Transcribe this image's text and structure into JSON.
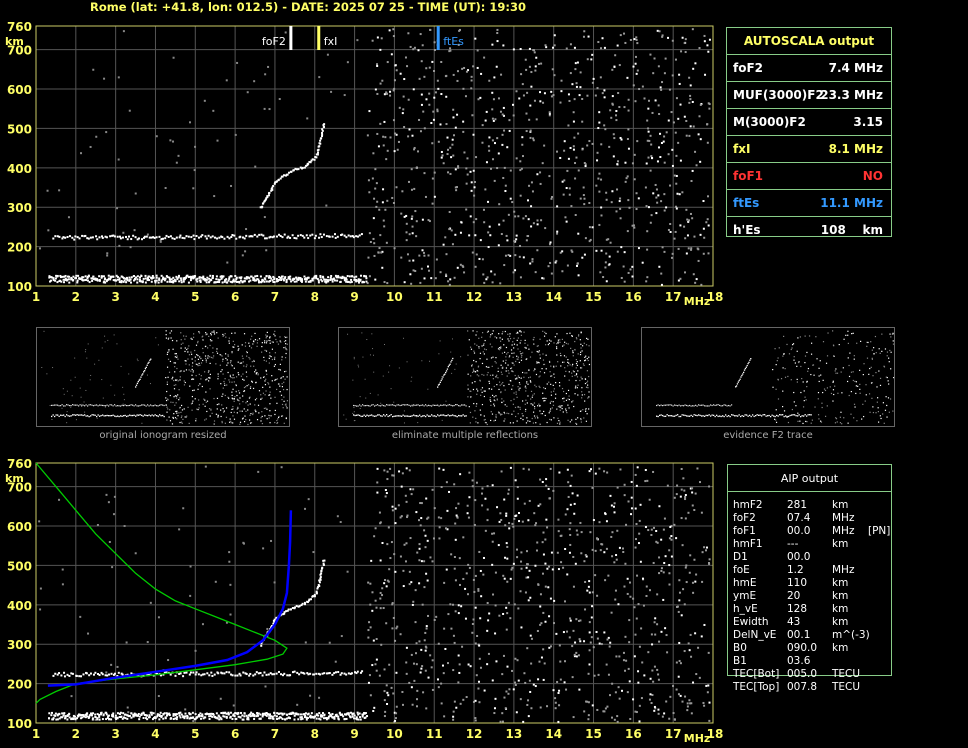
{
  "header": {
    "text": "Rome (lat: +41.8, lon: 012.5) - DATE: 2025 07 25 - TIME (UT): 19:30"
  },
  "top_plot": {
    "markers": {
      "foF2": "foF2",
      "fxI": "fxI",
      "ftEs": "ftEs"
    }
  },
  "autoscala": {
    "title": "AUTOSCALA output",
    "rows": [
      {
        "label": "foF2",
        "value": "7.4 MHz",
        "color": "#ffffff"
      },
      {
        "label": "MUF(3000)F2",
        "value": "23.3 MHz",
        "color": "#ffffff"
      },
      {
        "label": "M(3000)F2",
        "value": "3.15",
        "color": "#ffffff"
      },
      {
        "label": "fxI",
        "value": "8.1 MHz",
        "color": "#ffff66"
      },
      {
        "label": "foF1",
        "value": "NO",
        "color": "#ff3333"
      },
      {
        "label": "ftEs",
        "value": "11.1 MHz",
        "color": "#3399ff"
      },
      {
        "label": "h'Es",
        "value": "108    km",
        "color": "#ffffff"
      }
    ]
  },
  "thumbnails": [
    {
      "caption": "original ionogram resized"
    },
    {
      "caption": "eliminate multiple reflections"
    },
    {
      "caption": "evidence F2 trace"
    }
  ],
  "aip": {
    "title": "AIP output",
    "rows": [
      {
        "name": "hmF2",
        "value": "281",
        "unit": "km",
        "extra": ""
      },
      {
        "name": "foF2",
        "value": "07.4",
        "unit": "MHz",
        "extra": ""
      },
      {
        "name": "foF1",
        "value": "00.0",
        "unit": "MHz",
        "extra": "[PN]"
      },
      {
        "name": "hmF1",
        "value": "---",
        "unit": "km",
        "extra": ""
      },
      {
        "name": "D1",
        "value": "00.0",
        "unit": "",
        "extra": ""
      },
      {
        "name": "foE",
        "value": "1.2",
        "unit": "MHz",
        "extra": ""
      },
      {
        "name": "hmE",
        "value": "110",
        "unit": "km",
        "extra": ""
      },
      {
        "name": "ymE",
        "value": "20",
        "unit": "km",
        "extra": ""
      },
      {
        "name": "h_vE",
        "value": "128",
        "unit": "km",
        "extra": ""
      },
      {
        "name": "Ewidth",
        "value": "43",
        "unit": "km",
        "extra": ""
      },
      {
        "name": "DelN_vE",
        "value": "00.1",
        "unit": "m^(-3)",
        "extra": ""
      },
      {
        "name": "B0",
        "value": "090.0",
        "unit": "km",
        "extra": ""
      },
      {
        "name": "B1",
        "value": "03.6",
        "unit": "",
        "extra": ""
      },
      {
        "name": "TEC[Bot]",
        "value": "005.0",
        "unit": "TECU",
        "extra": ""
      },
      {
        "name": "TEC[Top]",
        "value": "007.8",
        "unit": "TECU",
        "extra": ""
      }
    ]
  },
  "chart_data": [
    {
      "type": "scatter",
      "name": "ionogram",
      "xlabel": "MHz",
      "ylabel": "km",
      "xlim": [
        1,
        18
      ],
      "ylim": [
        100,
        760
      ],
      "xticks": [
        1,
        2,
        3,
        4,
        5,
        6,
        7,
        8,
        9,
        10,
        11,
        12,
        13,
        14,
        15,
        16,
        17,
        18
      ],
      "yticks": [
        100,
        200,
        300,
        400,
        500,
        600,
        700,
        760
      ],
      "grid": true,
      "markers": [
        {
          "name": "foF2",
          "x": 7.4,
          "color": "#ffffff"
        },
        {
          "name": "fxI",
          "x": 8.1,
          "color": "#ffff66"
        },
        {
          "name": "ftEs",
          "x": 11.1,
          "color": "#3399ff"
        }
      ],
      "traces": [
        {
          "name": "Es layer",
          "points": [
            [
              1.3,
              120
            ],
            [
              3,
              120
            ],
            [
              5,
              120
            ],
            [
              7,
              120
            ],
            [
              9.3,
              120
            ]
          ]
        },
        {
          "name": "Es second hop",
          "points": [
            [
              1.4,
              225
            ],
            [
              4,
              226
            ],
            [
              7,
              228
            ],
            [
              9.2,
              230
            ]
          ]
        },
        {
          "name": "F2 trace",
          "points": [
            [
              6.6,
              300
            ],
            [
              7.0,
              370
            ],
            [
              7.4,
              395
            ],
            [
              7.7,
              405
            ],
            [
              8.0,
              430
            ],
            [
              8.1,
              470
            ],
            [
              8.2,
              520
            ]
          ]
        }
      ]
    },
    {
      "type": "line",
      "name": "profile",
      "xlabel": "MHz",
      "ylabel": "km",
      "xlim": [
        1,
        18
      ],
      "ylim": [
        100,
        760
      ],
      "xticks": [
        1,
        2,
        3,
        4,
        5,
        6,
        7,
        8,
        9,
        10,
        11,
        12,
        13,
        14,
        15,
        16,
        17,
        18
      ],
      "yticks": [
        100,
        200,
        300,
        400,
        500,
        600,
        700,
        760
      ],
      "grid": true,
      "series": [
        {
          "color": "#00cc00",
          "points": [
            [
              1.0,
              760
            ],
            [
              1.5,
              700
            ],
            [
              2.0,
              640
            ],
            [
              2.5,
              580
            ],
            [
              3.0,
              530
            ],
            [
              3.5,
              480
            ],
            [
              4.0,
              440
            ],
            [
              4.5,
              410
            ],
            [
              5.0,
              390
            ],
            [
              5.5,
              370
            ],
            [
              6.0,
              350
            ],
            [
              6.5,
              330
            ],
            [
              7.0,
              310
            ],
            [
              7.3,
              290
            ],
            [
              7.2,
              275
            ],
            [
              6.8,
              262
            ],
            [
              6.0,
              248
            ],
            [
              5.0,
              235
            ],
            [
              4.0,
              222
            ],
            [
              3.0,
              212
            ],
            [
              2.0,
              200
            ],
            [
              1.5,
              180
            ],
            [
              1.1,
              160
            ],
            [
              1.0,
              150
            ]
          ]
        },
        {
          "color": "#0000ff",
          "points": [
            [
              1.3,
              195
            ],
            [
              2.0,
              198
            ],
            [
              3.0,
              215
            ],
            [
              4.0,
              230
            ],
            [
              5.0,
              245
            ],
            [
              5.8,
              260
            ],
            [
              6.3,
              280
            ],
            [
              6.7,
              310
            ],
            [
              7.0,
              350
            ],
            [
              7.2,
              390
            ],
            [
              7.3,
              430
            ],
            [
              7.35,
              500
            ],
            [
              7.38,
              560
            ],
            [
              7.4,
              640
            ]
          ]
        }
      ],
      "traces": [
        {
          "name": "Es layer",
          "points": [
            [
              1.3,
              120
            ],
            [
              3,
              120
            ],
            [
              5,
              120
            ],
            [
              7,
              120
            ],
            [
              9.3,
              120
            ]
          ]
        },
        {
          "name": "Es second hop",
          "points": [
            [
              1.4,
              225
            ],
            [
              4,
              226
            ],
            [
              7,
              228
            ],
            [
              9.2,
              230
            ]
          ]
        },
        {
          "name": "F2 trace",
          "points": [
            [
              6.6,
              300
            ],
            [
              7.0,
              370
            ],
            [
              7.4,
              395
            ],
            [
              7.7,
              405
            ],
            [
              8.0,
              430
            ],
            [
              8.1,
              470
            ],
            [
              8.2,
              520
            ]
          ]
        }
      ]
    }
  ]
}
